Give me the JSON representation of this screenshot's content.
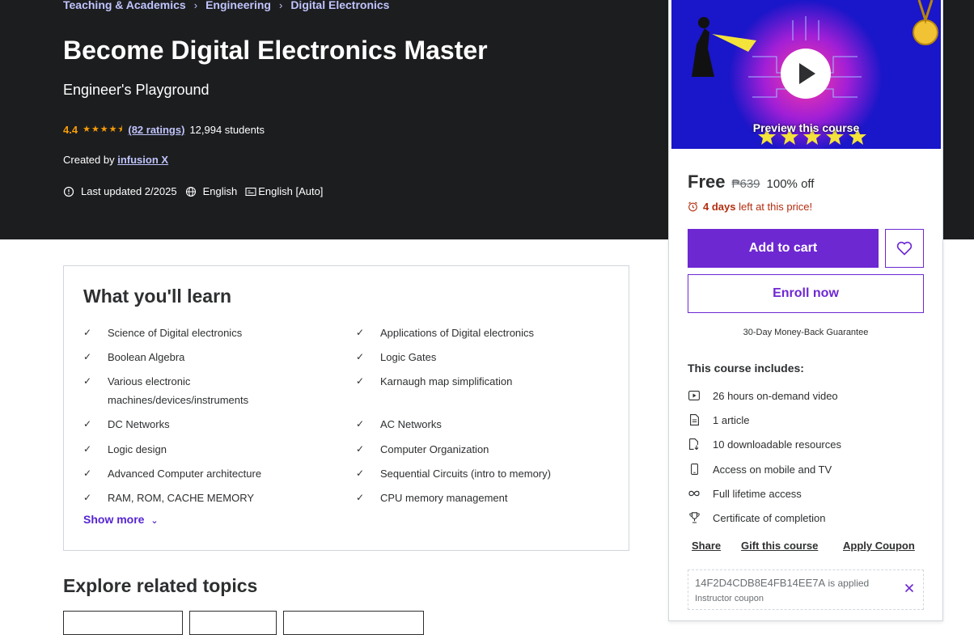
{
  "breadcrumb": [
    "Teaching & Academics",
    "Engineering",
    "Digital Electronics"
  ],
  "course": {
    "title": "Become Digital Electronics Master",
    "subtitle": "Engineer's Playground",
    "rating": "4.4",
    "rating_value": 4.4,
    "ratings_link": "(82 ratings)",
    "students": "12,994 students",
    "created_by_label": "Created by",
    "instructor": "infusion X",
    "last_updated": "Last updated 2/2025",
    "language": "English",
    "captions": "English [Auto]"
  },
  "learn": {
    "heading": "What you'll learn",
    "left": [
      "Science of Digital electronics",
      "Boolean Algebra",
      "Various electronic machines/devices/instruments",
      "DC Networks",
      "Logic design",
      "Advanced Computer architecture",
      "RAM, ROM, CACHE MEMORY"
    ],
    "right": [
      "Applications of Digital electronics",
      "Logic Gates",
      "Karnaugh map simplification",
      "AC Networks",
      "Computer Organization",
      "Sequential Circuits (intro to memory)",
      "CPU memory management"
    ],
    "show_more": "Show more"
  },
  "explore_heading": "Explore related topics",
  "sidebar": {
    "preview_label": "Preview this course",
    "price": "Free",
    "original_price": "₱639",
    "discount": "100% off",
    "time_left_bold": "4 days",
    "time_left_rest": "left at this price!",
    "add_to_cart": "Add to cart",
    "enroll_now": "Enroll now",
    "guarantee": "30-Day Money-Back Guarantee",
    "includes_title": "This course includes:",
    "includes": [
      {
        "icon": "video-icon",
        "label": "26 hours on-demand video"
      },
      {
        "icon": "article-icon",
        "label": "1 article"
      },
      {
        "icon": "download-icon",
        "label": "10 downloadable resources"
      },
      {
        "icon": "mobile-icon",
        "label": "Access on mobile and TV"
      },
      {
        "icon": "infinity-icon",
        "label": "Full lifetime access"
      },
      {
        "icon": "trophy-icon",
        "label": "Certificate of completion"
      }
    ],
    "share": "Share",
    "gift": "Gift this course",
    "apply_coupon": "Apply Coupon",
    "coupon_code": "14F2D4CDB8E4FB14EE7A",
    "coupon_applied": "is applied",
    "coupon_type": "Instructor coupon"
  },
  "colors": {
    "hero_bg": "#1c1d1f",
    "accent_purple": "#6d28d2",
    "link_lavender": "#c0c4fc",
    "star_orange": "#f69c08",
    "alert_red": "#b32d0f"
  }
}
